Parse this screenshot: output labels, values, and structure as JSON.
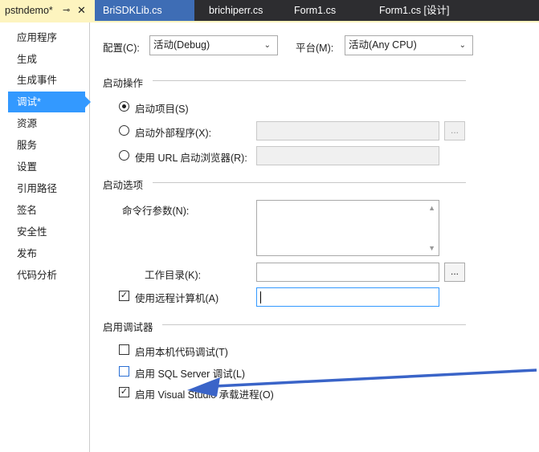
{
  "tabs": [
    {
      "label": "pstndemo*",
      "active": true
    },
    {
      "label": "BriSDKLib.cs"
    },
    {
      "label": "brichiperr.cs"
    },
    {
      "label": "Form1.cs"
    },
    {
      "label": "Form1.cs [设计]"
    }
  ],
  "tab_icons": {
    "pin": "⊸",
    "close": "✕"
  },
  "sidebar": {
    "items": [
      {
        "label": "应用程序"
      },
      {
        "label": "生成"
      },
      {
        "label": "生成事件"
      },
      {
        "label": "调试*",
        "active": true
      },
      {
        "label": "资源"
      },
      {
        "label": "服务"
      },
      {
        "label": "设置"
      },
      {
        "label": "引用路径"
      },
      {
        "label": "签名"
      },
      {
        "label": "安全性"
      },
      {
        "label": "发布"
      },
      {
        "label": "代码分析"
      }
    ]
  },
  "config": {
    "config_label": "配置(C):",
    "config_value": "活动(Debug)",
    "platform_label": "平台(M):",
    "platform_value": "活动(Any CPU)"
  },
  "start_action": {
    "title": "启动操作",
    "start_project": "启动项目(S)",
    "start_external": "启动外部程序(X):",
    "start_url": "使用 URL 启动浏览器(R):",
    "browse_label": "..."
  },
  "start_options": {
    "title": "启动选项",
    "cmd_args_label": "命令行参数(N):",
    "working_dir_label": "工作目录(K):",
    "remote_label": "使用远程计算机(A)",
    "remote_checked": true,
    "browse_label": "..."
  },
  "debuggers": {
    "title": "启用调试器",
    "native": "启用本机代码调试(T)",
    "native_checked": false,
    "sql": "启用 SQL Server 调试(L)",
    "sql_checked": false,
    "vshost": "启用 Visual Studio 承载进程(O)",
    "vshost_checked": true
  },
  "colors": {
    "tab_active": "#fdf4bf",
    "tab_bar": "#2d2d30",
    "tab_blue": "#3e6db5",
    "sidebar_active": "#3399ff",
    "arrow": "#3a64c8"
  },
  "check_mark": "✓",
  "chevron": "⌄"
}
